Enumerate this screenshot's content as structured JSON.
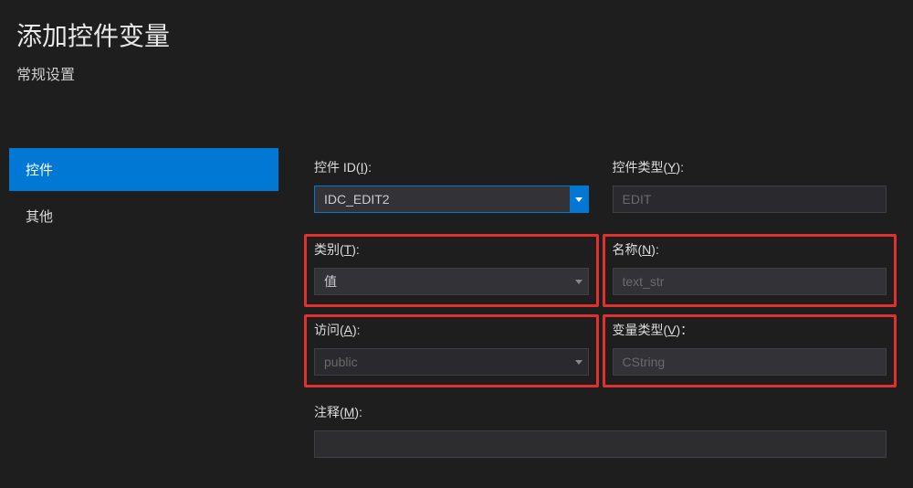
{
  "header": {
    "title": "添加控件变量",
    "subtitle": "常规设置"
  },
  "sidebar": {
    "items": [
      {
        "label": "控件",
        "selected": true
      },
      {
        "label": "其他",
        "selected": false
      }
    ]
  },
  "form": {
    "controlId": {
      "label_prefix": "控件 ID(",
      "label_key": "I",
      "label_suffix": "):",
      "value": "IDC_EDIT2"
    },
    "controlType": {
      "label_prefix": "控件类型(",
      "label_key": "Y",
      "label_suffix": "):",
      "value": "EDIT"
    },
    "category": {
      "label_prefix": "类别(",
      "label_key": "T",
      "label_suffix": "):",
      "value": "值"
    },
    "name": {
      "label_prefix": "名称(",
      "label_key": "N",
      "label_suffix": "):",
      "value": "text_str"
    },
    "access": {
      "label_prefix": "访问(",
      "label_key": "A",
      "label_suffix": "):",
      "value": "public"
    },
    "varType": {
      "label_prefix": "变量类型(",
      "label_key": "V",
      "label_suffix": ")：",
      "value": "CString"
    },
    "comment": {
      "label_prefix": "注释(",
      "label_key": "M",
      "label_suffix": "):",
      "value": ""
    }
  }
}
